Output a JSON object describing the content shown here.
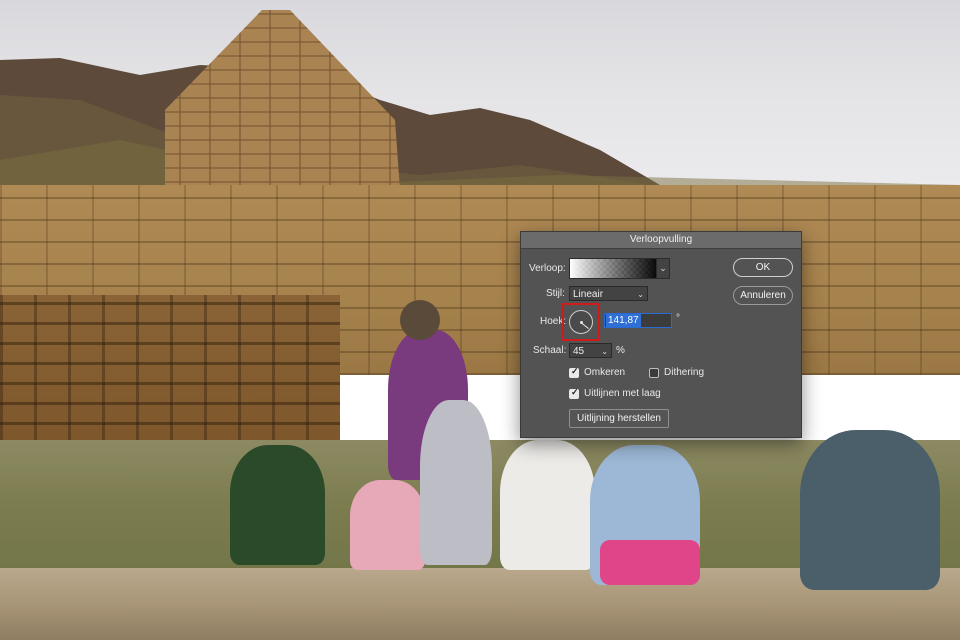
{
  "dialog": {
    "title": "Verloopvulling",
    "gradient_label": "Verloop:",
    "style_label": "Stijl:",
    "style_value": "Lineair",
    "angle_label": "Hoek:",
    "angle_value": "141,87",
    "angle_unit": "°",
    "scale_label": "Schaal:",
    "scale_value": "45",
    "scale_unit": "%",
    "reverse_label": "Omkeren",
    "reverse_checked": true,
    "dither_label": "Dithering",
    "dither_checked": false,
    "align_label": "Uitlijnen met laag",
    "align_checked": true,
    "reset_alignment_label": "Uitlijning herstellen",
    "ok_label": "OK",
    "cancel_label": "Annuleren",
    "highlight_color": "#d11b1b",
    "selection_color": "#2f6fd6"
  }
}
